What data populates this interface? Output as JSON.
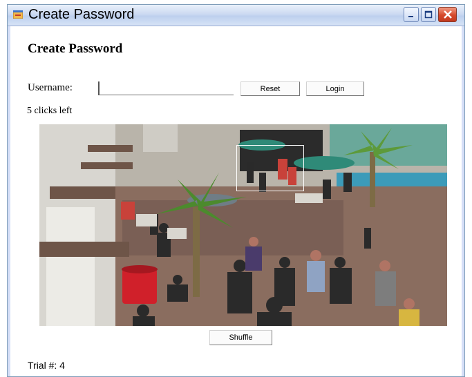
{
  "window": {
    "title": "Create Password",
    "controls": [
      "minimize-icon",
      "maximize-icon",
      "close-icon"
    ]
  },
  "form": {
    "heading": "Create Password",
    "username_label": "Username:",
    "username_value": "",
    "reset_label": "Reset",
    "login_label": "Login",
    "clicks_left": "5 clicks left",
    "shuffle_label": "Shuffle",
    "trial_label": "Trial #:  4"
  },
  "colors": {
    "title_bar": "#cbd9f1",
    "close_button": "#d5492b",
    "selection_box": "#ffffff"
  }
}
